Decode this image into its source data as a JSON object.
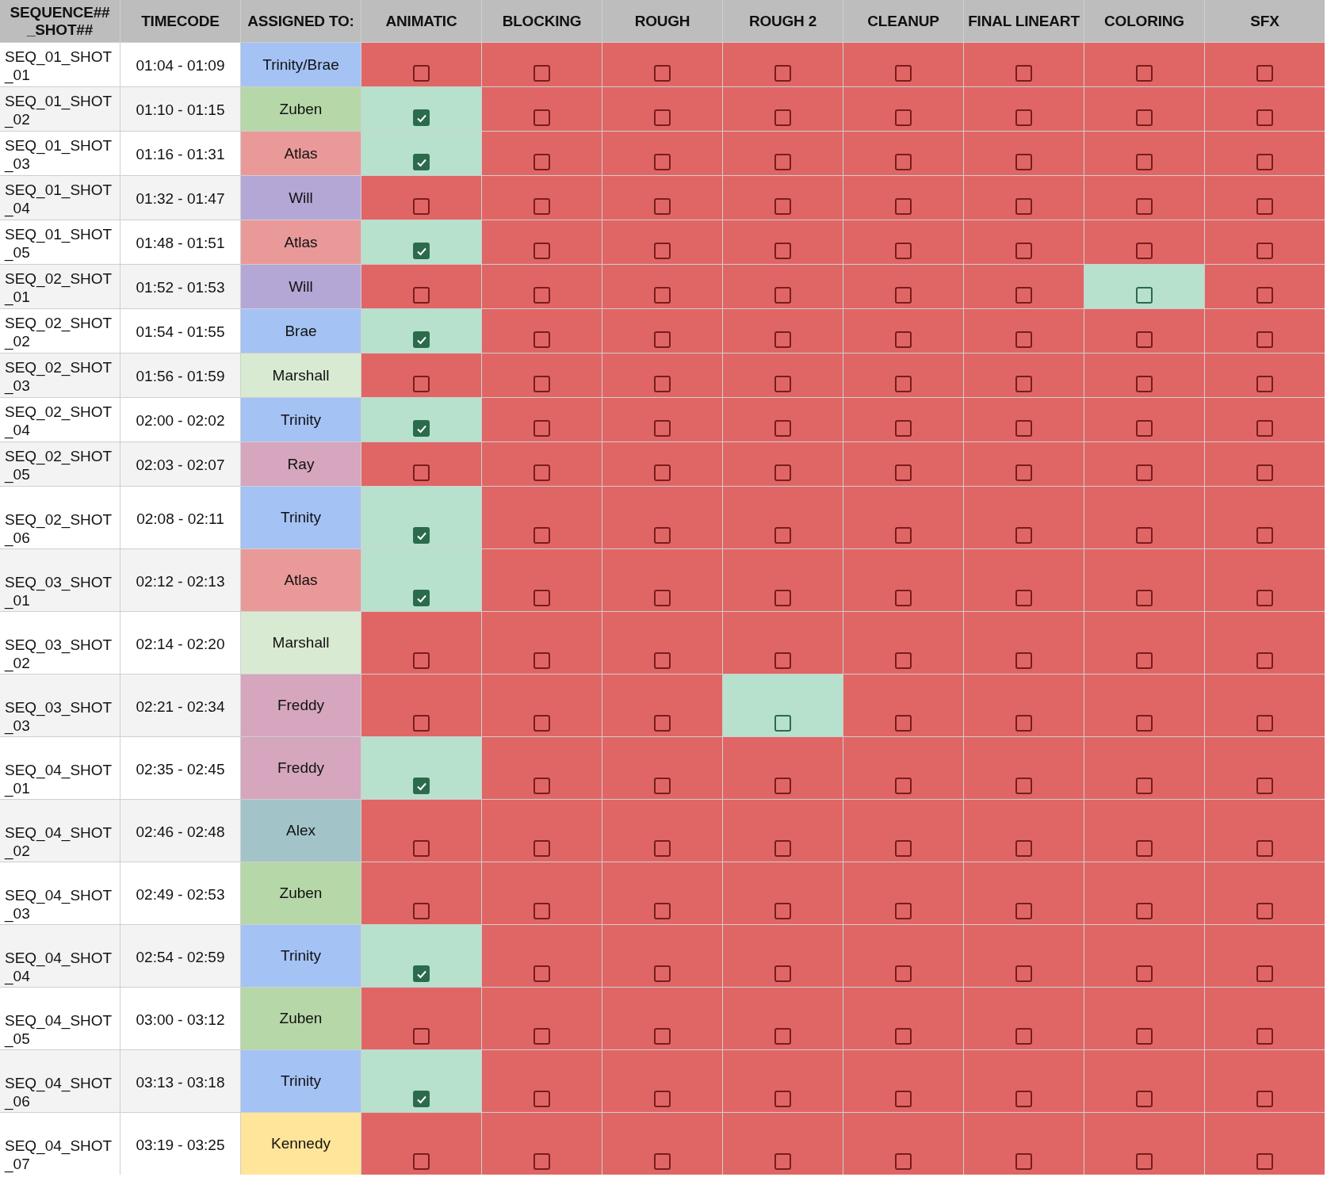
{
  "columns": [
    "SEQUENCE##_SHOT##",
    "TIMECODE",
    "ASSIGNED TO:",
    "ANIMATIC",
    "BLOCKING",
    "ROUGH",
    "ROUGH 2",
    "CLEANUP",
    "FINAL LINEART",
    "COLORING",
    "SFX"
  ],
  "rows": [
    {
      "shot": "SEQ_01_SHOT_01",
      "timecode": "01:04 - 01:09",
      "assignee": {
        "name": "Trinity/Brae",
        "color": "#a4c2f4"
      },
      "stages": [
        {
          "checked": false,
          "highlighted": false
        },
        {
          "checked": false,
          "highlighted": false
        },
        {
          "checked": false,
          "highlighted": false
        },
        {
          "checked": false,
          "highlighted": false
        },
        {
          "checked": false,
          "highlighted": false
        },
        {
          "checked": false,
          "highlighted": false
        },
        {
          "checked": false,
          "highlighted": false
        },
        {
          "checked": false,
          "highlighted": false
        }
      ]
    },
    {
      "shot": "SEQ_01_SHOT_02",
      "timecode": "01:10 - 01:15",
      "assignee": {
        "name": "Zuben",
        "color": "#b6d7a8"
      },
      "stages": [
        {
          "checked": true,
          "highlighted": true
        },
        {
          "checked": false,
          "highlighted": false
        },
        {
          "checked": false,
          "highlighted": false
        },
        {
          "checked": false,
          "highlighted": false
        },
        {
          "checked": false,
          "highlighted": false
        },
        {
          "checked": false,
          "highlighted": false
        },
        {
          "checked": false,
          "highlighted": false
        },
        {
          "checked": false,
          "highlighted": false
        }
      ]
    },
    {
      "shot": "SEQ_01_SHOT_03",
      "timecode": "01:16 - 01:31",
      "assignee": {
        "name": "Atlas",
        "color": "#ea9999"
      },
      "stages": [
        {
          "checked": true,
          "highlighted": true
        },
        {
          "checked": false,
          "highlighted": false
        },
        {
          "checked": false,
          "highlighted": false
        },
        {
          "checked": false,
          "highlighted": false
        },
        {
          "checked": false,
          "highlighted": false
        },
        {
          "checked": false,
          "highlighted": false
        },
        {
          "checked": false,
          "highlighted": false
        },
        {
          "checked": false,
          "highlighted": false
        }
      ]
    },
    {
      "shot": "SEQ_01_SHOT_04",
      "timecode": "01:32 - 01:47",
      "assignee": {
        "name": "Will",
        "color": "#b4a7d6"
      },
      "stages": [
        {
          "checked": false,
          "highlighted": false
        },
        {
          "checked": false,
          "highlighted": false
        },
        {
          "checked": false,
          "highlighted": false
        },
        {
          "checked": false,
          "highlighted": false
        },
        {
          "checked": false,
          "highlighted": false
        },
        {
          "checked": false,
          "highlighted": false
        },
        {
          "checked": false,
          "highlighted": false
        },
        {
          "checked": false,
          "highlighted": false
        }
      ]
    },
    {
      "shot": "SEQ_01_SHOT_05",
      "timecode": "01:48 - 01:51",
      "assignee": {
        "name": "Atlas",
        "color": "#ea9999"
      },
      "stages": [
        {
          "checked": true,
          "highlighted": true
        },
        {
          "checked": false,
          "highlighted": false
        },
        {
          "checked": false,
          "highlighted": false
        },
        {
          "checked": false,
          "highlighted": false
        },
        {
          "checked": false,
          "highlighted": false
        },
        {
          "checked": false,
          "highlighted": false
        },
        {
          "checked": false,
          "highlighted": false
        },
        {
          "checked": false,
          "highlighted": false
        }
      ]
    },
    {
      "shot": "SEQ_02_SHOT_01",
      "timecode": "01:52 - 01:53",
      "assignee": {
        "name": "Will",
        "color": "#b4a7d6"
      },
      "stages": [
        {
          "checked": false,
          "highlighted": false
        },
        {
          "checked": false,
          "highlighted": false
        },
        {
          "checked": false,
          "highlighted": false
        },
        {
          "checked": false,
          "highlighted": false
        },
        {
          "checked": false,
          "highlighted": false
        },
        {
          "checked": false,
          "highlighted": false
        },
        {
          "checked": false,
          "highlighted": true
        },
        {
          "checked": false,
          "highlighted": false
        }
      ]
    },
    {
      "shot": "SEQ_02_SHOT_02",
      "timecode": "01:54 - 01:55",
      "assignee": {
        "name": "Brae",
        "color": "#a4c2f4"
      },
      "stages": [
        {
          "checked": true,
          "highlighted": true
        },
        {
          "checked": false,
          "highlighted": false
        },
        {
          "checked": false,
          "highlighted": false
        },
        {
          "checked": false,
          "highlighted": false
        },
        {
          "checked": false,
          "highlighted": false
        },
        {
          "checked": false,
          "highlighted": false
        },
        {
          "checked": false,
          "highlighted": false
        },
        {
          "checked": false,
          "highlighted": false
        }
      ]
    },
    {
      "shot": "SEQ_02_SHOT_03",
      "timecode": "01:56 - 01:59",
      "assignee": {
        "name": "Marshall",
        "color": "#d9ead3"
      },
      "stages": [
        {
          "checked": false,
          "highlighted": false
        },
        {
          "checked": false,
          "highlighted": false
        },
        {
          "checked": false,
          "highlighted": false
        },
        {
          "checked": false,
          "highlighted": false
        },
        {
          "checked": false,
          "highlighted": false
        },
        {
          "checked": false,
          "highlighted": false
        },
        {
          "checked": false,
          "highlighted": false
        },
        {
          "checked": false,
          "highlighted": false
        }
      ]
    },
    {
      "shot": "SEQ_02_SHOT_04",
      "timecode": "02:00 - 02:02",
      "assignee": {
        "name": "Trinity",
        "color": "#a4c2f4"
      },
      "stages": [
        {
          "checked": true,
          "highlighted": true
        },
        {
          "checked": false,
          "highlighted": false
        },
        {
          "checked": false,
          "highlighted": false
        },
        {
          "checked": false,
          "highlighted": false
        },
        {
          "checked": false,
          "highlighted": false
        },
        {
          "checked": false,
          "highlighted": false
        },
        {
          "checked": false,
          "highlighted": false
        },
        {
          "checked": false,
          "highlighted": false
        }
      ]
    },
    {
      "shot": "SEQ_02_SHOT_05",
      "timecode": "02:03 - 02:07",
      "assignee": {
        "name": "Ray",
        "color": "#d5a6bd"
      },
      "stages": [
        {
          "checked": false,
          "highlighted": false
        },
        {
          "checked": false,
          "highlighted": false
        },
        {
          "checked": false,
          "highlighted": false
        },
        {
          "checked": false,
          "highlighted": false
        },
        {
          "checked": false,
          "highlighted": false
        },
        {
          "checked": false,
          "highlighted": false
        },
        {
          "checked": false,
          "highlighted": false
        },
        {
          "checked": false,
          "highlighted": false
        }
      ]
    },
    {
      "shot": "SEQ_02_SHOT_06",
      "timecode": "02:08 - 02:11",
      "assignee": {
        "name": "Trinity",
        "color": "#a4c2f4"
      },
      "stages": [
        {
          "checked": true,
          "highlighted": true
        },
        {
          "checked": false,
          "highlighted": false
        },
        {
          "checked": false,
          "highlighted": false
        },
        {
          "checked": false,
          "highlighted": false
        },
        {
          "checked": false,
          "highlighted": false
        },
        {
          "checked": false,
          "highlighted": false
        },
        {
          "checked": false,
          "highlighted": false
        },
        {
          "checked": false,
          "highlighted": false
        }
      ]
    },
    {
      "shot": "SEQ_03_SHOT_01",
      "timecode": "02:12 - 02:13",
      "assignee": {
        "name": "Atlas",
        "color": "#ea9999"
      },
      "stages": [
        {
          "checked": true,
          "highlighted": true
        },
        {
          "checked": false,
          "highlighted": false
        },
        {
          "checked": false,
          "highlighted": false
        },
        {
          "checked": false,
          "highlighted": false
        },
        {
          "checked": false,
          "highlighted": false
        },
        {
          "checked": false,
          "highlighted": false
        },
        {
          "checked": false,
          "highlighted": false
        },
        {
          "checked": false,
          "highlighted": false
        }
      ]
    },
    {
      "shot": "SEQ_03_SHOT_02",
      "timecode": "02:14 - 02:20",
      "assignee": {
        "name": "Marshall",
        "color": "#d9ead3"
      },
      "stages": [
        {
          "checked": false,
          "highlighted": false
        },
        {
          "checked": false,
          "highlighted": false
        },
        {
          "checked": false,
          "highlighted": false
        },
        {
          "checked": false,
          "highlighted": false
        },
        {
          "checked": false,
          "highlighted": false
        },
        {
          "checked": false,
          "highlighted": false
        },
        {
          "checked": false,
          "highlighted": false
        },
        {
          "checked": false,
          "highlighted": false
        }
      ]
    },
    {
      "shot": "SEQ_03_SHOT_03",
      "timecode": "02:21 - 02:34",
      "assignee": {
        "name": "Freddy",
        "color": "#d5a6bd"
      },
      "stages": [
        {
          "checked": false,
          "highlighted": false
        },
        {
          "checked": false,
          "highlighted": false
        },
        {
          "checked": false,
          "highlighted": false
        },
        {
          "checked": false,
          "highlighted": true
        },
        {
          "checked": false,
          "highlighted": false
        },
        {
          "checked": false,
          "highlighted": false
        },
        {
          "checked": false,
          "highlighted": false
        },
        {
          "checked": false,
          "highlighted": false
        }
      ]
    },
    {
      "shot": "SEQ_04_SHOT_01",
      "timecode": "02:35 - 02:45",
      "assignee": {
        "name": "Freddy",
        "color": "#d5a6bd"
      },
      "stages": [
        {
          "checked": true,
          "highlighted": true
        },
        {
          "checked": false,
          "highlighted": false
        },
        {
          "checked": false,
          "highlighted": false
        },
        {
          "checked": false,
          "highlighted": false
        },
        {
          "checked": false,
          "highlighted": false
        },
        {
          "checked": false,
          "highlighted": false
        },
        {
          "checked": false,
          "highlighted": false
        },
        {
          "checked": false,
          "highlighted": false
        }
      ]
    },
    {
      "shot": "SEQ_04_SHOT_02",
      "timecode": "02:46 - 02:48",
      "assignee": {
        "name": "Alex",
        "color": "#a2c4c9"
      },
      "stages": [
        {
          "checked": false,
          "highlighted": false
        },
        {
          "checked": false,
          "highlighted": false
        },
        {
          "checked": false,
          "highlighted": false
        },
        {
          "checked": false,
          "highlighted": false
        },
        {
          "checked": false,
          "highlighted": false
        },
        {
          "checked": false,
          "highlighted": false
        },
        {
          "checked": false,
          "highlighted": false
        },
        {
          "checked": false,
          "highlighted": false
        }
      ]
    },
    {
      "shot": "SEQ_04_SHOT_03",
      "timecode": "02:49 - 02:53",
      "assignee": {
        "name": "Zuben",
        "color": "#b6d7a8"
      },
      "stages": [
        {
          "checked": false,
          "highlighted": false
        },
        {
          "checked": false,
          "highlighted": false
        },
        {
          "checked": false,
          "highlighted": false
        },
        {
          "checked": false,
          "highlighted": false
        },
        {
          "checked": false,
          "highlighted": false
        },
        {
          "checked": false,
          "highlighted": false
        },
        {
          "checked": false,
          "highlighted": false
        },
        {
          "checked": false,
          "highlighted": false
        }
      ]
    },
    {
      "shot": "SEQ_04_SHOT_04",
      "timecode": "02:54 - 02:59",
      "assignee": {
        "name": "Trinity",
        "color": "#a4c2f4"
      },
      "stages": [
        {
          "checked": true,
          "highlighted": true
        },
        {
          "checked": false,
          "highlighted": false
        },
        {
          "checked": false,
          "highlighted": false
        },
        {
          "checked": false,
          "highlighted": false
        },
        {
          "checked": false,
          "highlighted": false
        },
        {
          "checked": false,
          "highlighted": false
        },
        {
          "checked": false,
          "highlighted": false
        },
        {
          "checked": false,
          "highlighted": false
        }
      ]
    },
    {
      "shot": "SEQ_04_SHOT_05",
      "timecode": "03:00 - 03:12",
      "assignee": {
        "name": "Zuben",
        "color": "#b6d7a8"
      },
      "stages": [
        {
          "checked": false,
          "highlighted": false
        },
        {
          "checked": false,
          "highlighted": false
        },
        {
          "checked": false,
          "highlighted": false
        },
        {
          "checked": false,
          "highlighted": false
        },
        {
          "checked": false,
          "highlighted": false
        },
        {
          "checked": false,
          "highlighted": false
        },
        {
          "checked": false,
          "highlighted": false
        },
        {
          "checked": false,
          "highlighted": false
        }
      ]
    },
    {
      "shot": "SEQ_04_SHOT_06",
      "timecode": "03:13 - 03:18",
      "assignee": {
        "name": "Trinity",
        "color": "#a4c2f4"
      },
      "stages": [
        {
          "checked": true,
          "highlighted": true
        },
        {
          "checked": false,
          "highlighted": false
        },
        {
          "checked": false,
          "highlighted": false
        },
        {
          "checked": false,
          "highlighted": false
        },
        {
          "checked": false,
          "highlighted": false
        },
        {
          "checked": false,
          "highlighted": false
        },
        {
          "checked": false,
          "highlighted": false
        },
        {
          "checked": false,
          "highlighted": false
        }
      ]
    },
    {
      "shot": "SEQ_04_SHOT_07",
      "timecode": "03:19 - 03:25",
      "assignee": {
        "name": "Kennedy",
        "color": "#ffe599"
      },
      "stages": [
        {
          "checked": false,
          "highlighted": false
        },
        {
          "checked": false,
          "highlighted": false
        },
        {
          "checked": false,
          "highlighted": false
        },
        {
          "checked": false,
          "highlighted": false
        },
        {
          "checked": false,
          "highlighted": false
        },
        {
          "checked": false,
          "highlighted": false
        },
        {
          "checked": false,
          "highlighted": false
        },
        {
          "checked": false,
          "highlighted": false
        }
      ]
    }
  ]
}
